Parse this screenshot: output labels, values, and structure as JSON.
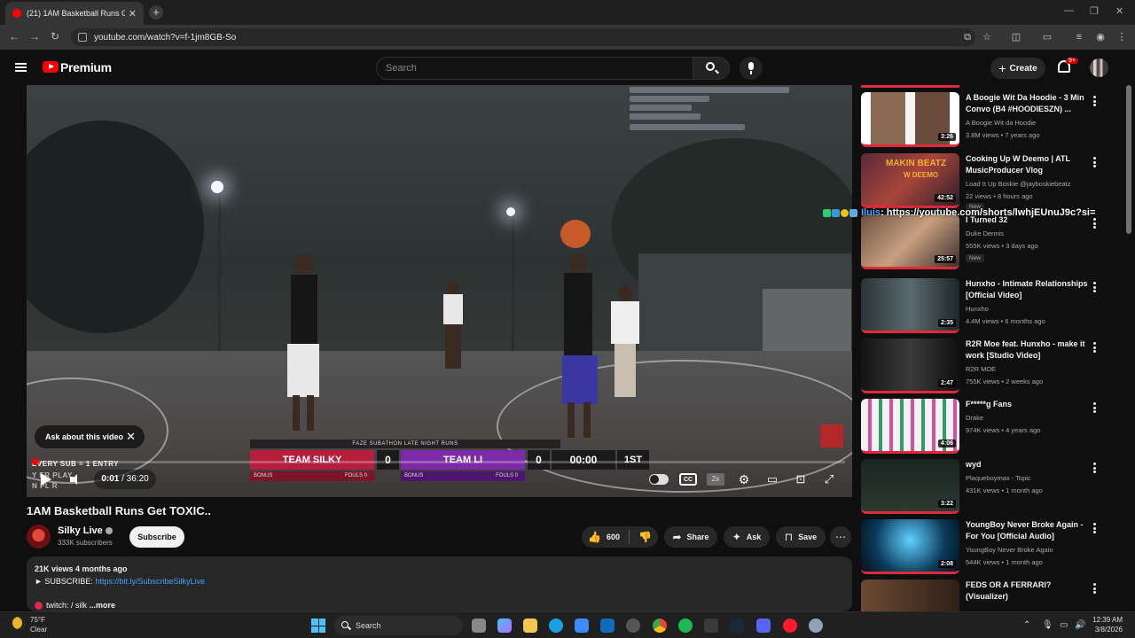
{
  "browser": {
    "tab_title": "(21) 1AM Basketball Runs Get T",
    "tab_close": "✕",
    "new_tab": "+",
    "url": "youtube.com/watch?v=f-1jm8GB-So",
    "window_controls": [
      "—",
      "❐",
      "✕"
    ]
  },
  "header": {
    "brand": "Premium",
    "search_placeholder": "Search",
    "create_label": "Create",
    "notifications_badge": "9+"
  },
  "video": {
    "scoreboard": {
      "event": "FAZE SUBATHON LATE NIGHT RUNS",
      "team1": "TEAM SILKY",
      "score1": "0",
      "team2": "TEAM LI",
      "score2": "0",
      "clock": "00:00",
      "period": "1ST",
      "bonus1": "BONUS",
      "fouls1": "FOULS  0",
      "bonus2": "BONUS",
      "fouls2": "FOULS  0"
    },
    "overlay_lines": [
      "EVERY SUB = 1 ENTRY",
      "Y    ER    PLAY",
      "N    PL    R"
    ],
    "ask_label": "Ask about this video",
    "time_current": "0:01",
    "time_total": " / 36:20",
    "speed_label": "2x",
    "progress_fraction": 0.0005
  },
  "details": {
    "title": "1AM Basketball Runs Get TOXIC..",
    "channel": "Silky Live",
    "subscribers": "333K subscribers",
    "subscribe_label": "Subscribe",
    "likes": "600",
    "share_label": "Share",
    "ask_label": "Ask",
    "save_label": "Save",
    "views_line": "21K views  4 months ago",
    "subscribe_prefix": "► SUBSCRIBE: ",
    "subscribe_link": "https://bit.ly/SubscribeSilkyLive",
    "twitch_line": "twitch:",
    "twitch_handle": " / silk",
    "more_label": "...more"
  },
  "overlay_url": {
    "user": "Iluis",
    "url": ": https://youtube.com/shorts/lwhjEUnuJ9c?si="
  },
  "recommendations": [
    {
      "title": "A Boogie Wit Da Hoodie - 3 Min Convo (B4 #HOODIESZN) ...",
      "channel": "A Boogie Wit da Hoodie",
      "meta": "3.8M views • 7 years ago",
      "duration": "3:26",
      "new": ""
    },
    {
      "title": "Cooking Up W Deemo | ATL MusicProducer Vlog",
      "channel": "Load It Up Boskie @jayboskiebeatz",
      "meta": "22 views • 8 hours ago",
      "duration": "42:52",
      "new": "New",
      "thumb_text": "MAKIN BEATZ",
      "thumb_sub": "W DEEMO"
    },
    {
      "title": "I Turned 32",
      "channel": "Duke Dennis",
      "meta": "555K views • 3 days ago",
      "duration": "25:57",
      "new": "New"
    },
    {
      "title": "Hunxho - Intimate Relationships [Official Video]",
      "channel": "Hunxho",
      "meta": "4.4M views • 6 months ago",
      "duration": "2:35",
      "new": ""
    },
    {
      "title": "R2R Moe feat. Hunxho - make it work [Studio Video]",
      "channel": "R2R MOE",
      "meta": "755K views • 2 weeks ago",
      "duration": "2:47",
      "new": ""
    },
    {
      "title": "F*****g Fans",
      "channel": "Drake",
      "meta": "974K views • 4 years ago",
      "duration": "4:06",
      "new": ""
    },
    {
      "title": "wyd",
      "channel": "Plaqueboymax - Topic",
      "meta": "431K views • 1 month ago",
      "duration": "3:22",
      "new": ""
    },
    {
      "title": "YoungBoy Never Broke Again - For You [Official Audio]",
      "channel": "YoungBoy Never Broke Again",
      "meta": "544K views • 1 month ago",
      "duration": "2:08",
      "new": ""
    },
    {
      "title": "FEDS OR A FERRARI? (Visualizer)",
      "channel": "",
      "meta": "",
      "duration": "",
      "new": ""
    }
  ],
  "taskbar": {
    "temp": "75°F",
    "weather": "Clear",
    "search_label": "Search",
    "time": "12:39 AM",
    "date": "3/8/2026"
  },
  "colors": {
    "accent": "#ff0000",
    "link": "#3ea6ff",
    "team1": "#b51e3c",
    "team2": "#7c2aa8"
  }
}
